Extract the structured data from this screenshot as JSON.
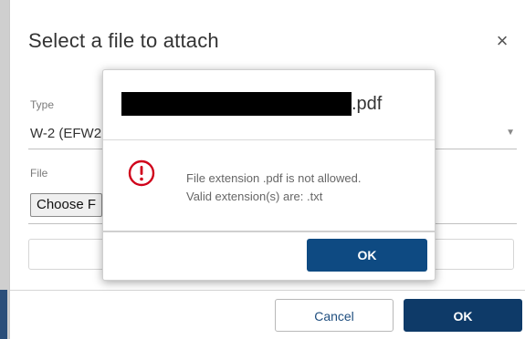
{
  "dialog": {
    "title": "Select a file to attach",
    "close_icon": "close-icon",
    "close_glyph": "×",
    "type_label": "Type",
    "type_value": "W-2 (EFW2",
    "file_label": "File",
    "choose_file_label": "Choose F",
    "cancel_label": "Cancel",
    "ok_label": "OK"
  },
  "alert": {
    "filename_suffix": ".pdf",
    "icon": "error-icon",
    "message_line1": "File extension .pdf is not allowed.",
    "message_line2": "Valid extension(s) are: .txt",
    "ok_label": "OK"
  },
  "colors": {
    "primary": "#0e3a68",
    "alert_primary": "#0e4a82",
    "error": "#d0021b"
  }
}
